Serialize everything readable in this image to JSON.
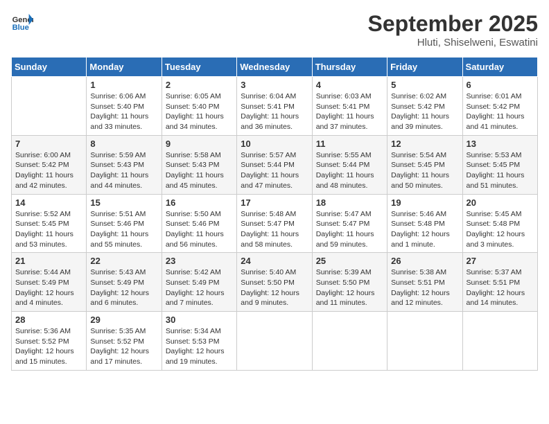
{
  "header": {
    "logo_general": "General",
    "logo_blue": "Blue",
    "month_title": "September 2025",
    "location": "Hluti, Shiselweni, Eswatini"
  },
  "days_of_week": [
    "Sunday",
    "Monday",
    "Tuesday",
    "Wednesday",
    "Thursday",
    "Friday",
    "Saturday"
  ],
  "weeks": [
    [
      {
        "day": "",
        "info": ""
      },
      {
        "day": "1",
        "info": "Sunrise: 6:06 AM\nSunset: 5:40 PM\nDaylight: 11 hours\nand 33 minutes."
      },
      {
        "day": "2",
        "info": "Sunrise: 6:05 AM\nSunset: 5:40 PM\nDaylight: 11 hours\nand 34 minutes."
      },
      {
        "day": "3",
        "info": "Sunrise: 6:04 AM\nSunset: 5:41 PM\nDaylight: 11 hours\nand 36 minutes."
      },
      {
        "day": "4",
        "info": "Sunrise: 6:03 AM\nSunset: 5:41 PM\nDaylight: 11 hours\nand 37 minutes."
      },
      {
        "day": "5",
        "info": "Sunrise: 6:02 AM\nSunset: 5:42 PM\nDaylight: 11 hours\nand 39 minutes."
      },
      {
        "day": "6",
        "info": "Sunrise: 6:01 AM\nSunset: 5:42 PM\nDaylight: 11 hours\nand 41 minutes."
      }
    ],
    [
      {
        "day": "7",
        "info": "Sunrise: 6:00 AM\nSunset: 5:42 PM\nDaylight: 11 hours\nand 42 minutes."
      },
      {
        "day": "8",
        "info": "Sunrise: 5:59 AM\nSunset: 5:43 PM\nDaylight: 11 hours\nand 44 minutes."
      },
      {
        "day": "9",
        "info": "Sunrise: 5:58 AM\nSunset: 5:43 PM\nDaylight: 11 hours\nand 45 minutes."
      },
      {
        "day": "10",
        "info": "Sunrise: 5:57 AM\nSunset: 5:44 PM\nDaylight: 11 hours\nand 47 minutes."
      },
      {
        "day": "11",
        "info": "Sunrise: 5:55 AM\nSunset: 5:44 PM\nDaylight: 11 hours\nand 48 minutes."
      },
      {
        "day": "12",
        "info": "Sunrise: 5:54 AM\nSunset: 5:45 PM\nDaylight: 11 hours\nand 50 minutes."
      },
      {
        "day": "13",
        "info": "Sunrise: 5:53 AM\nSunset: 5:45 PM\nDaylight: 11 hours\nand 51 minutes."
      }
    ],
    [
      {
        "day": "14",
        "info": "Sunrise: 5:52 AM\nSunset: 5:45 PM\nDaylight: 11 hours\nand 53 minutes."
      },
      {
        "day": "15",
        "info": "Sunrise: 5:51 AM\nSunset: 5:46 PM\nDaylight: 11 hours\nand 55 minutes."
      },
      {
        "day": "16",
        "info": "Sunrise: 5:50 AM\nSunset: 5:46 PM\nDaylight: 11 hours\nand 56 minutes."
      },
      {
        "day": "17",
        "info": "Sunrise: 5:48 AM\nSunset: 5:47 PM\nDaylight: 11 hours\nand 58 minutes."
      },
      {
        "day": "18",
        "info": "Sunrise: 5:47 AM\nSunset: 5:47 PM\nDaylight: 11 hours\nand 59 minutes."
      },
      {
        "day": "19",
        "info": "Sunrise: 5:46 AM\nSunset: 5:48 PM\nDaylight: 12 hours\nand 1 minute."
      },
      {
        "day": "20",
        "info": "Sunrise: 5:45 AM\nSunset: 5:48 PM\nDaylight: 12 hours\nand 3 minutes."
      }
    ],
    [
      {
        "day": "21",
        "info": "Sunrise: 5:44 AM\nSunset: 5:49 PM\nDaylight: 12 hours\nand 4 minutes."
      },
      {
        "day": "22",
        "info": "Sunrise: 5:43 AM\nSunset: 5:49 PM\nDaylight: 12 hours\nand 6 minutes."
      },
      {
        "day": "23",
        "info": "Sunrise: 5:42 AM\nSunset: 5:49 PM\nDaylight: 12 hours\nand 7 minutes."
      },
      {
        "day": "24",
        "info": "Sunrise: 5:40 AM\nSunset: 5:50 PM\nDaylight: 12 hours\nand 9 minutes."
      },
      {
        "day": "25",
        "info": "Sunrise: 5:39 AM\nSunset: 5:50 PM\nDaylight: 12 hours\nand 11 minutes."
      },
      {
        "day": "26",
        "info": "Sunrise: 5:38 AM\nSunset: 5:51 PM\nDaylight: 12 hours\nand 12 minutes."
      },
      {
        "day": "27",
        "info": "Sunrise: 5:37 AM\nSunset: 5:51 PM\nDaylight: 12 hours\nand 14 minutes."
      }
    ],
    [
      {
        "day": "28",
        "info": "Sunrise: 5:36 AM\nSunset: 5:52 PM\nDaylight: 12 hours\nand 15 minutes."
      },
      {
        "day": "29",
        "info": "Sunrise: 5:35 AM\nSunset: 5:52 PM\nDaylight: 12 hours\nand 17 minutes."
      },
      {
        "day": "30",
        "info": "Sunrise: 5:34 AM\nSunset: 5:53 PM\nDaylight: 12 hours\nand 19 minutes."
      },
      {
        "day": "",
        "info": ""
      },
      {
        "day": "",
        "info": ""
      },
      {
        "day": "",
        "info": ""
      },
      {
        "day": "",
        "info": ""
      }
    ]
  ]
}
